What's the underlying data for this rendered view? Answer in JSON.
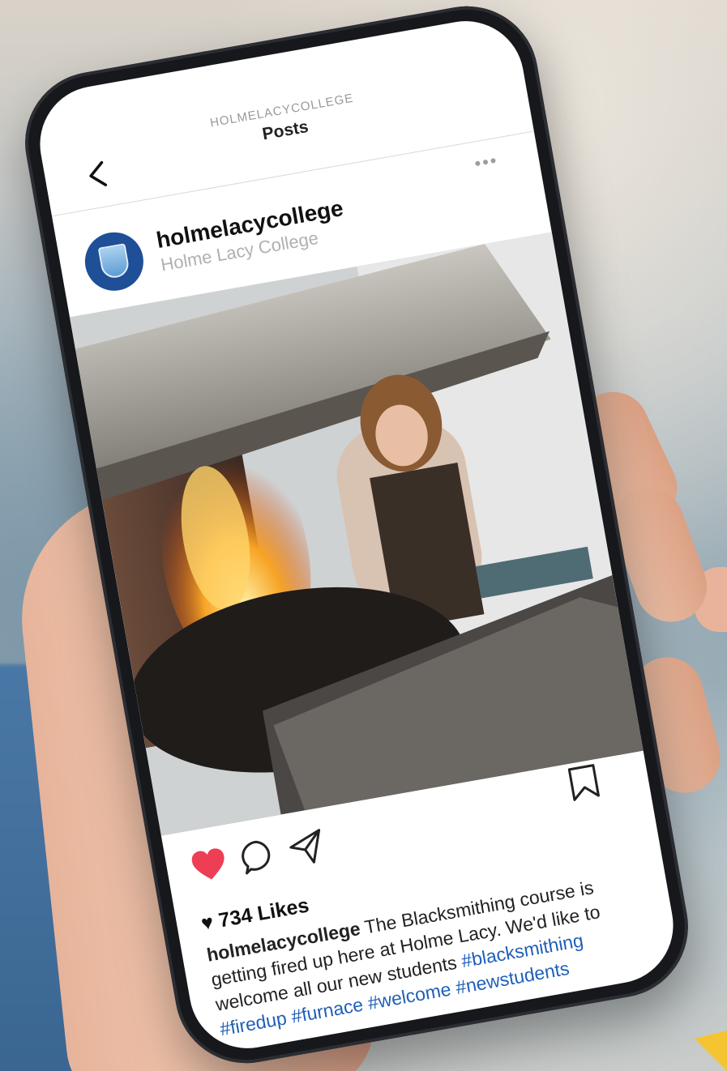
{
  "header": {
    "account": "HOLMELACYCOLLEGE",
    "title": "Posts",
    "more": "•••"
  },
  "post": {
    "username": "holmelacycollege",
    "fullname": "Holme Lacy College",
    "likes": "734 Likes",
    "liked": true,
    "caption": {
      "user": "holmelacycollege",
      "text": "The Blacksmithing course is getting fired up here at Holme Lacy. We'd like to welcome all our new students",
      "hashtags": [
        "#blacksmithing",
        "#firedup",
        "#furnace",
        "#welcome",
        "#newstudents"
      ]
    }
  },
  "colors": {
    "like_red": "#ee3e55",
    "hashtag_blue": "#1f5fb8",
    "avatar_blue": "#1e4f97"
  },
  "icons": [
    "back-icon",
    "more-icon",
    "heart-icon",
    "comment-icon",
    "share-icon",
    "bookmark-icon"
  ]
}
